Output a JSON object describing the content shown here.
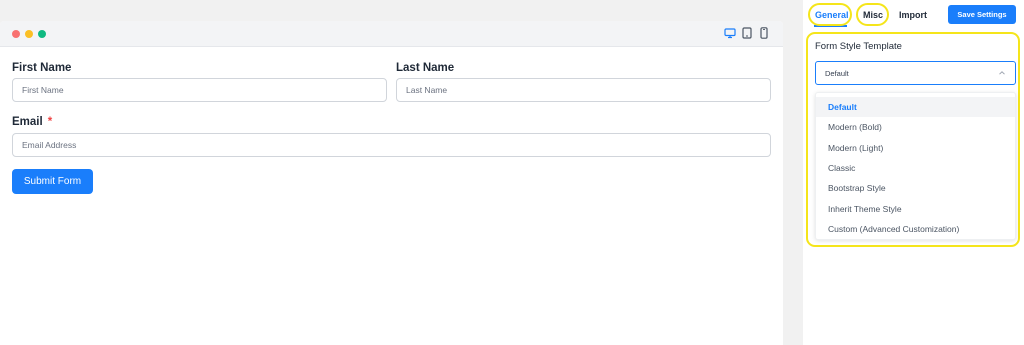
{
  "preview": {
    "device_icons": [
      "desktop-icon",
      "tablet-icon",
      "mobile-icon"
    ],
    "form": {
      "first_name": {
        "label": "First Name",
        "placeholder": "First Name"
      },
      "last_name": {
        "label": "Last Name",
        "placeholder": "Last Name"
      },
      "email": {
        "label": "Email",
        "required_mark": "*",
        "placeholder": "Email Address"
      },
      "submit_label": "Submit Form"
    }
  },
  "settings": {
    "tabs": [
      {
        "label": "General",
        "active": true
      },
      {
        "label": "Misc",
        "active": false
      },
      {
        "label": "Import",
        "active": false
      }
    ],
    "save_label": "Save Settings",
    "form_style": {
      "title": "Form Style Template",
      "selected": "Default",
      "options": [
        "Default",
        "Modern (Bold)",
        "Modern (Light)",
        "Classic",
        "Bootstrap Style",
        "Inherit Theme Style",
        "Custom (Advanced Customization)"
      ]
    }
  },
  "colors": {
    "accent": "#1a7efb",
    "highlight": "#f5e51a",
    "required": "#ef4444"
  }
}
